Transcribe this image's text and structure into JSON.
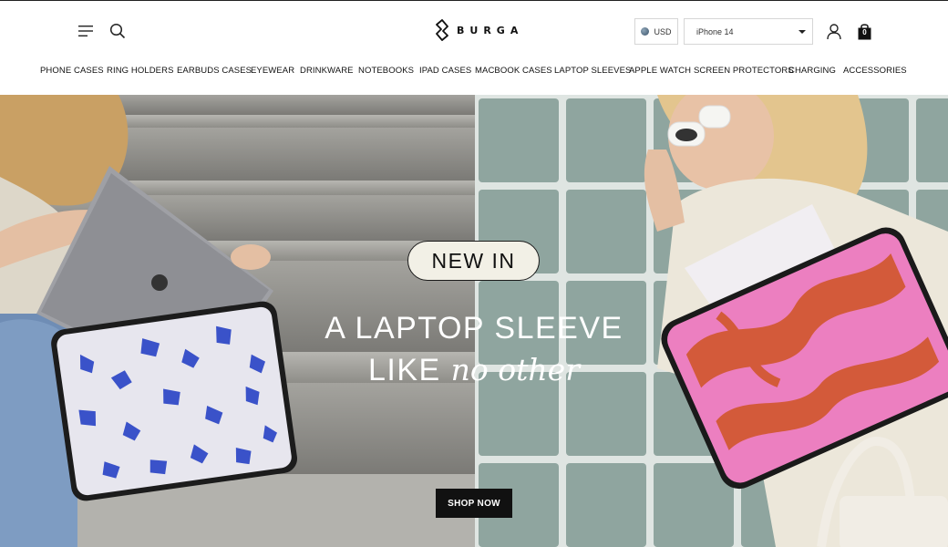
{
  "brand": {
    "name": "BURGA"
  },
  "header": {
    "currency": "USD",
    "device_select": "iPhone 14",
    "cart_count": "0"
  },
  "nav": {
    "items": [
      "PHONE CASES",
      "RING HOLDERS",
      "EARBUDS CASES",
      "EYEWEAR",
      "DRINKWARE",
      "NOTEBOOKS",
      "IPAD CASES",
      "MACBOOK CASES",
      "LAPTOP SLEEVES",
      "APPLE WATCH",
      "SCREEN PROTECTORS",
      "CHARGING",
      "ACCESSORIES"
    ]
  },
  "hero": {
    "badge": "NEW IN",
    "headline_line1": "A LAPTOP SLEEVE",
    "headline_line2_prefix": "LIKE",
    "headline_line2_italic": "no other",
    "cta": "SHOP NOW"
  },
  "icons": {
    "menu": "menu-icon",
    "search": "search-icon",
    "account": "account-icon",
    "cart": "cart-icon",
    "globe": "globe-icon",
    "dropdown": "chevron-down-icon"
  },
  "colors": {
    "text": "#111111",
    "cta_bg": "#111111",
    "badge_bg": "#f2f0e6",
    "sleeve_pink": "#ec7fc0",
    "sleeve_orange": "#d35a3a",
    "butterfly_blue": "#3a52c9"
  }
}
